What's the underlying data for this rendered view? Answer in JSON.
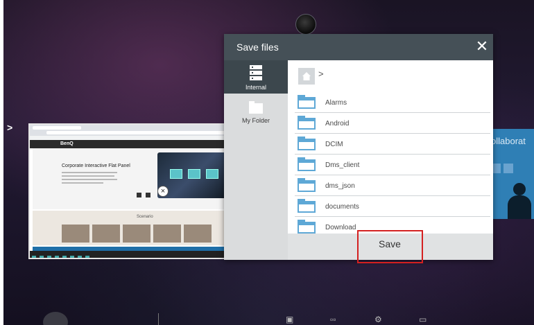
{
  "dialog": {
    "title": "Save files",
    "close_glyph": "✕",
    "sidebar": [
      {
        "label": "Internal",
        "icon": "server-icon",
        "active": true
      },
      {
        "label": "My Folder",
        "icon": "folder-icon",
        "active": false
      }
    ],
    "path_separator": ">",
    "folders": [
      "Alarms",
      "Android",
      "DCIM",
      "Dms_client",
      "dms_json",
      "documents",
      "Download"
    ],
    "save_label": "Save"
  },
  "background": {
    "collab_text": "ollaborat",
    "side_arrow": ">"
  },
  "thumbnail": {
    "site_logo": "BenQ",
    "hero_title": "Corporate Interactive Flat Panel",
    "section_label": "Scenario"
  },
  "colors": {
    "header": "#455057",
    "folder": "#5ea8d6",
    "highlight": "#d42020"
  }
}
